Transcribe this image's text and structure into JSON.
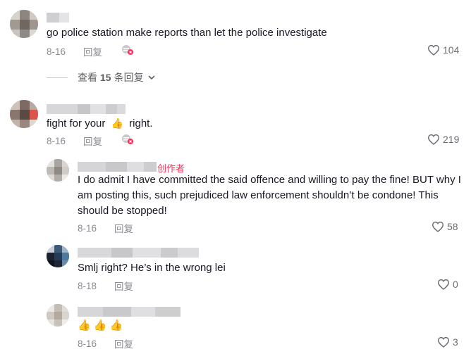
{
  "comments": [
    {
      "text": "go police station make reports than let the police investigate",
      "date": "8-16",
      "reply_label": "回复",
      "likes": "104"
    },
    {
      "text_before": "fight for your",
      "emoji": "👍",
      "text_after": "right.",
      "date": "8-16",
      "reply_label": "回复",
      "likes": "219"
    }
  ],
  "view_replies": {
    "prefix": "查看",
    "count": "15",
    "suffix": "条回复"
  },
  "replies": [
    {
      "creator_badge": "创作者",
      "line1": "I do admit I have committed the said offence and willing to pay the fine! BUT why I",
      "line2": "am posting this, such prejudiced law enforcement shouldn’t be condone! This",
      "line3": "should be stopped!",
      "date": "8-16",
      "reply_label": "回复",
      "likes": "58"
    },
    {
      "text": "Smlj right? He’s in the wrong lei",
      "date": "8-18",
      "reply_label": "回复",
      "likes": "0"
    },
    {
      "emojis": "👍 👍 👍",
      "date": "8-16",
      "reply_label": "回复",
      "likes": "3"
    }
  ],
  "colors": {
    "creator": "#fe2c55",
    "meta": "#8a8b91",
    "text": "#161823"
  },
  "icons": [
    "heart-outline-icon",
    "chevron-down-icon",
    "liked-by-creator-icon"
  ]
}
